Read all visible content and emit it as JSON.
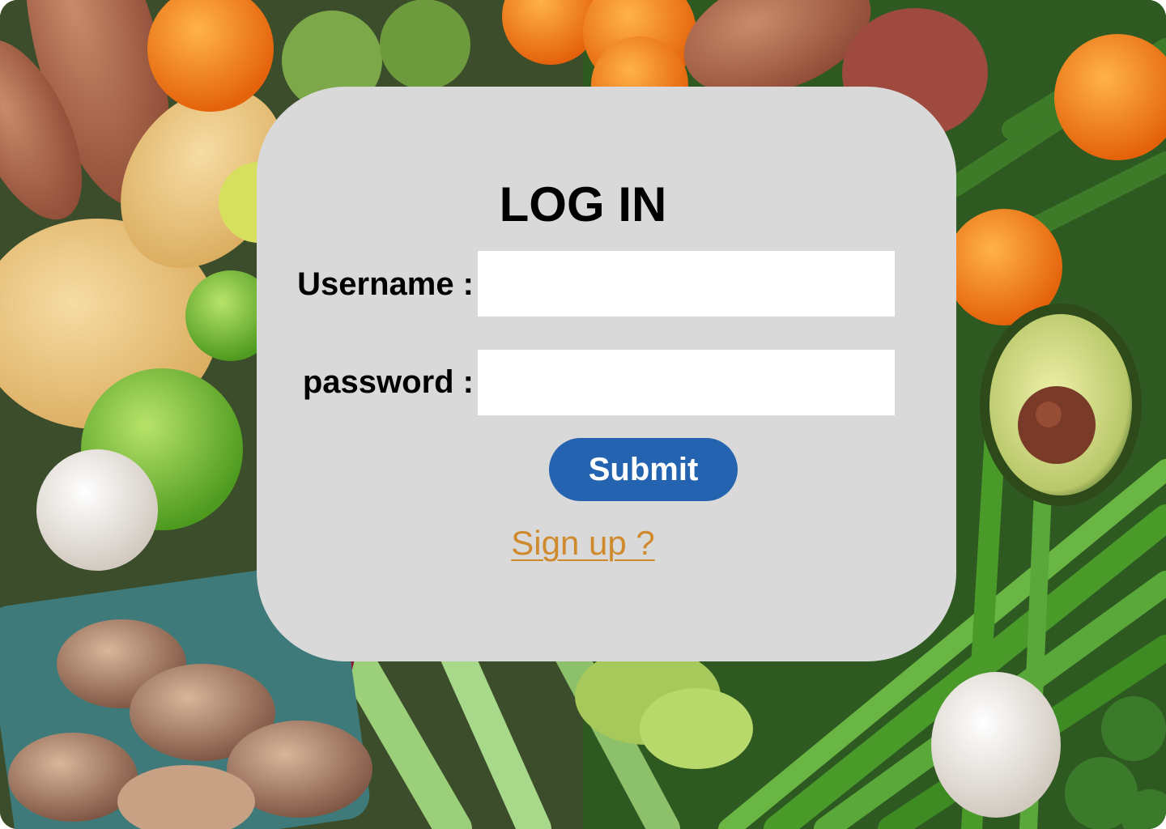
{
  "login": {
    "title": "LOG IN",
    "username_label": "Username :",
    "username_value": "",
    "password_label": "password :",
    "password_value": "",
    "submit_label": "Submit",
    "signup_link": "Sign up ?"
  },
  "colors": {
    "card_background": "#d9d9d9",
    "submit_background": "#2463b0",
    "submit_text": "#ffffff",
    "signup_link": "#d08a2e",
    "input_background": "#ffffff"
  },
  "background": {
    "image": "fresh-produce-photo"
  }
}
